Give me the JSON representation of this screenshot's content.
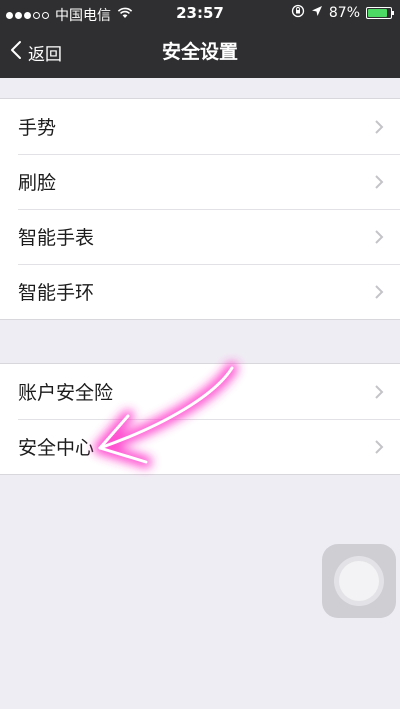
{
  "status_bar": {
    "carrier": "中国电信",
    "time": "23:57",
    "battery": "87%",
    "battery_level": 0.87
  },
  "nav": {
    "back_label": "返回",
    "title": "安全设置"
  },
  "groups": [
    {
      "items": [
        {
          "label": "手势"
        },
        {
          "label": "刷脸"
        },
        {
          "label": "智能手表"
        },
        {
          "label": "智能手环"
        }
      ]
    },
    {
      "items": [
        {
          "label": "账户安全险"
        },
        {
          "label": "安全中心"
        }
      ]
    }
  ],
  "colors": {
    "nav_background": "#2f2f31",
    "page_background": "#efedf4",
    "annotation_arrow": "#ff2fc8"
  },
  "icons": {
    "back": "chevron-left-icon",
    "row_disclosure": "chevron-right-icon",
    "wifi": "wifi-icon",
    "location": "location-arrow-icon",
    "rotation_lock": "rotation-lock-icon",
    "battery": "battery-icon"
  }
}
